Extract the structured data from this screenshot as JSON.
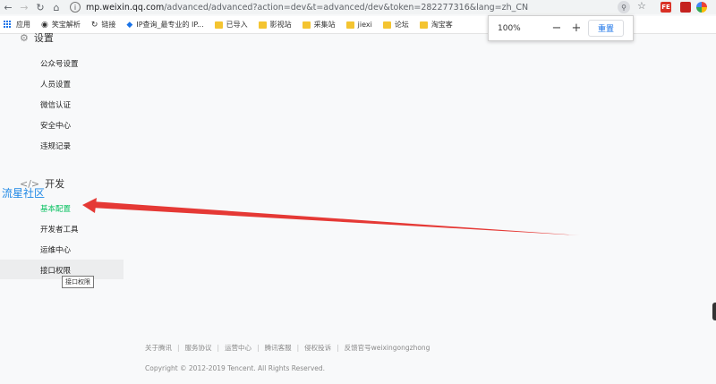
{
  "browser": {
    "url_host": "mp.weixin.qq.com",
    "url_path": "/advanced/advanced?action=dev&t=advanced/dev&token=282277316&lang=zh_CN",
    "bookmarks": [
      {
        "label": "应用",
        "icon": "apps-icon"
      },
      {
        "label": "笑宝解析",
        "icon": "globe-icon"
      },
      {
        "label": "链接",
        "icon": "refresh-icon"
      },
      {
        "label": "IP查询_最专业的 IP...",
        "icon": "diamond-icon"
      },
      {
        "label": "已导入",
        "icon": "folder-icon"
      },
      {
        "label": "影视站",
        "icon": "folder-icon"
      },
      {
        "label": "采集站",
        "icon": "folder-icon"
      },
      {
        "label": "jiexi",
        "icon": "folder-icon"
      },
      {
        "label": "论坛",
        "icon": "folder-icon"
      },
      {
        "label": "淘宝客",
        "icon": "folder-icon"
      }
    ],
    "zoom": {
      "percent": "100%",
      "minus": "−",
      "plus": "+",
      "reset_label": "重置"
    },
    "extensions": [
      {
        "label": "FE",
        "color": "#d93025"
      },
      {
        "label": "",
        "color": "#c5221f"
      },
      {
        "label": "",
        "color": "#f9ab00"
      }
    ]
  },
  "sidebar": {
    "settings_title": "设置",
    "settings_items": [
      "公众号设置",
      "人员设置",
      "微信认证",
      "安全中心",
      "违规记录"
    ],
    "dev_title": "开发",
    "dev_items": [
      "基本配置",
      "开发者工具",
      "运维中心",
      "接口权限"
    ],
    "active_item": "基本配置",
    "hovered_item": "接口权限",
    "tooltip": "接口权限"
  },
  "watermark": "流星社区",
  "footer": {
    "links": [
      "关于腾讯",
      "服务协议",
      "运营中心",
      "腾讯客服",
      "侵权投诉",
      "反馈官号weixingongzhong"
    ],
    "copyright": "Copyright © 2012-2019 Tencent. All Rights Reserved."
  },
  "colors": {
    "active": "#07c160",
    "arrow": "#e53935",
    "watermark": "#1e88e5",
    "link": "#1a73e8"
  }
}
